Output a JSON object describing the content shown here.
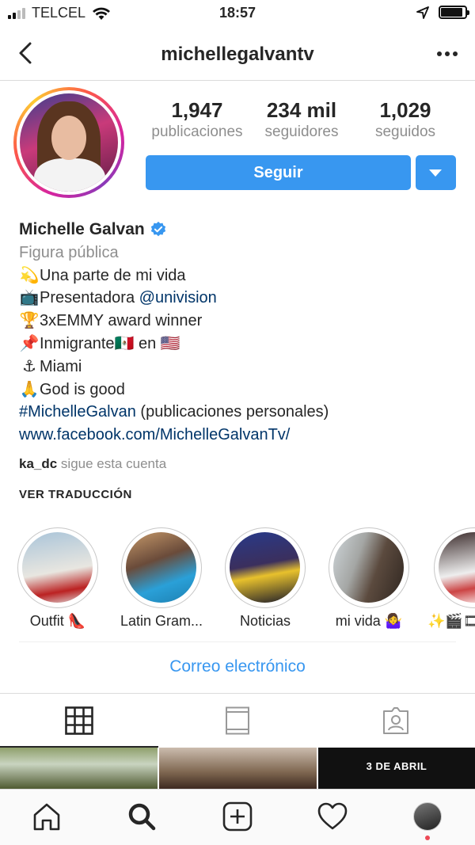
{
  "status_bar": {
    "carrier": "TELCEL",
    "time": "18:57",
    "battery_level": 0.9
  },
  "header": {
    "username": "michellegalvantv",
    "back_icon": "chevron-left-icon",
    "more_icon": "more-dots-icon"
  },
  "profile": {
    "stats": [
      {
        "value": "1,947",
        "label": "publicaciones"
      },
      {
        "value": "234 mil",
        "label": "seguidores"
      },
      {
        "value": "1,029",
        "label": "seguidos"
      }
    ],
    "follow_label": "Seguir",
    "accent_color": "#3897f0",
    "full_name": "Michelle Galvan",
    "category": "Figura pública",
    "bio_lines": [
      {
        "emoji": "💫",
        "text": "Una parte de mi vida"
      },
      {
        "emoji": "📺",
        "text": "Presentadora ",
        "mention": "@univision"
      },
      {
        "emoji": "🏆",
        "text": "3xEMMY award winner"
      },
      {
        "emoji": "📌",
        "text": "Inmigrante",
        "flag1": "🇲🇽",
        "mid": " en ",
        "flag2": "🇺🇸"
      },
      {
        "emoji": "⚓",
        "text": "Miami"
      },
      {
        "emoji": "🙏",
        "text": "God is good"
      }
    ],
    "hashtag": "#MichelleGalvan",
    "hashtag_rest": " (publicaciones personales)",
    "website": "www.facebook.com/MichelleGalvanTv/",
    "followed_by_user": "ka_dc",
    "followed_by_text": " sigue esta cuenta",
    "translate_label": "VER TRADUCCIÓN"
  },
  "highlights": [
    {
      "label": "Outfit 👠"
    },
    {
      "label": "Latin Gram..."
    },
    {
      "label": "Noticias"
    },
    {
      "label": "mi vida 🤷‍♀️"
    },
    {
      "label": "✨🎬🎞"
    }
  ],
  "email_label": "Correo electrónico",
  "tabs": [
    {
      "icon": "grid-icon",
      "active": true
    },
    {
      "icon": "feed-list-icon",
      "active": false
    },
    {
      "icon": "tagged-person-icon",
      "active": false
    }
  ],
  "grid_preview": [
    {
      "caption": ""
    },
    {
      "caption": ""
    },
    {
      "caption": "3 DE ABRIL"
    }
  ],
  "bottom_nav": [
    {
      "icon": "home-icon"
    },
    {
      "icon": "search-icon"
    },
    {
      "icon": "new-post-icon"
    },
    {
      "icon": "heart-icon"
    },
    {
      "icon": "profile-avatar-icon"
    }
  ]
}
